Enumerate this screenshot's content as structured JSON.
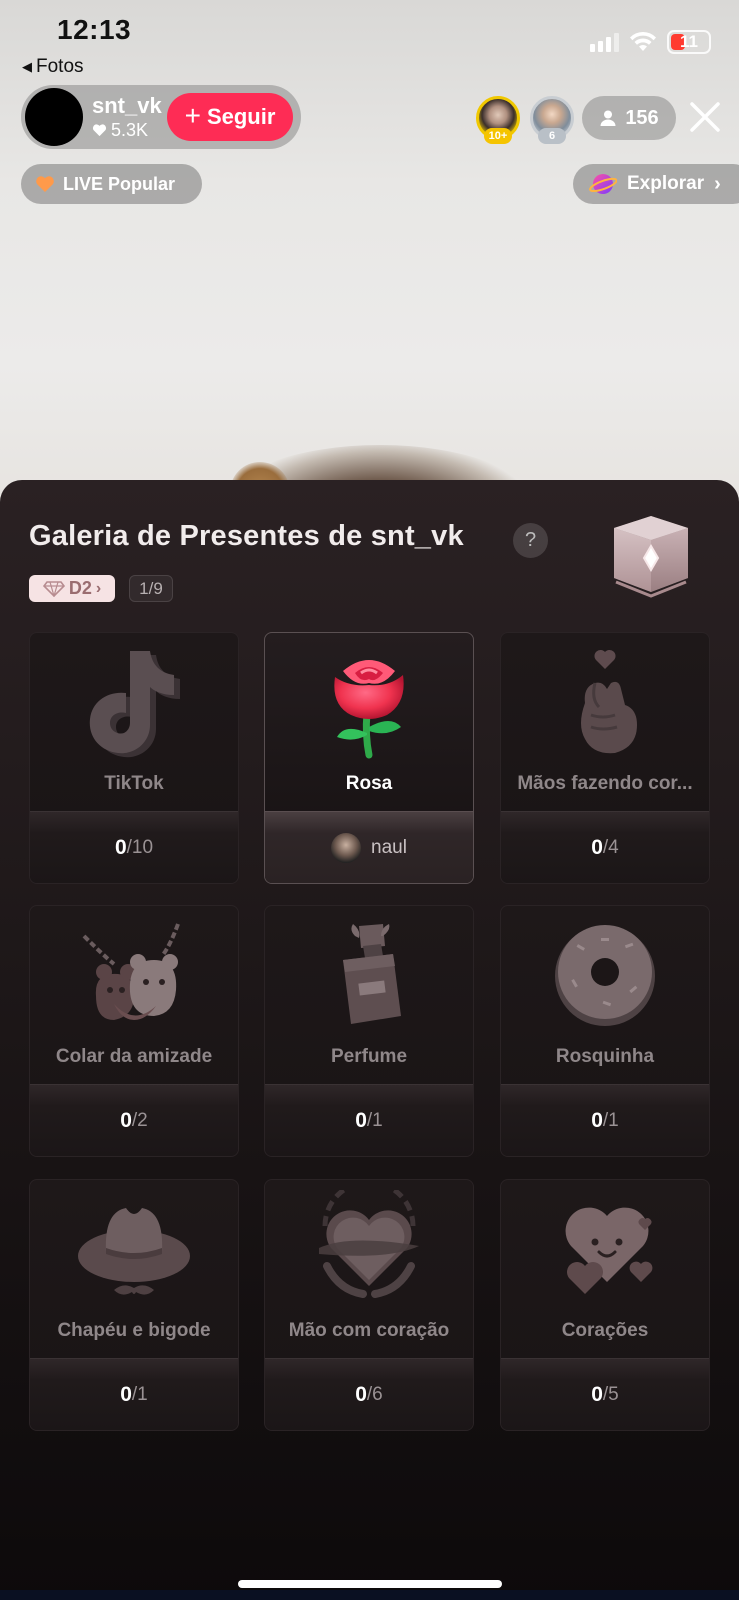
{
  "status_bar": {
    "time": "12:13",
    "battery_level": "11",
    "battery_color": "#ff3b30"
  },
  "back": {
    "label": "Fotos"
  },
  "host": {
    "username": "snt_vk",
    "likes": "5.3K",
    "follow_label": "Seguir",
    "follow_color": "#fe2c55"
  },
  "viewers": {
    "top1_badge": "10+",
    "top2_badge": "6",
    "count": "156"
  },
  "tags": {
    "live_popular": "LIVE Popular",
    "explore": "Explorar"
  },
  "gallery": {
    "title": "Galeria de Presentes de snt_vk",
    "help": "?",
    "level": "D2",
    "page": "1/9",
    "gifts": [
      {
        "name": "TikTok",
        "count": "0",
        "total": "/10",
        "icon": "tiktok-logo-icon"
      },
      {
        "name": "Rosa",
        "sender": "naul",
        "icon": "rose-icon",
        "active": true
      },
      {
        "name": "Mãos fazendo cor...",
        "count": "0",
        "total": "/4",
        "icon": "finger-heart-icon"
      },
      {
        "name": "Colar da amizade",
        "count": "0",
        "total": "/2",
        "icon": "friendship-necklace-icon"
      },
      {
        "name": "Perfume",
        "count": "0",
        "total": "/1",
        "icon": "perfume-icon"
      },
      {
        "name": "Rosquinha",
        "count": "0",
        "total": "/1",
        "icon": "donut-icon"
      },
      {
        "name": "Chapéu e bigode",
        "count": "0",
        "total": "/1",
        "icon": "hat-mustache-icon"
      },
      {
        "name": "Mão com coração",
        "count": "0",
        "total": "/6",
        "icon": "hand-heart-icon"
      },
      {
        "name": "Corações",
        "count": "0",
        "total": "/5",
        "icon": "hearts-icon"
      }
    ]
  }
}
